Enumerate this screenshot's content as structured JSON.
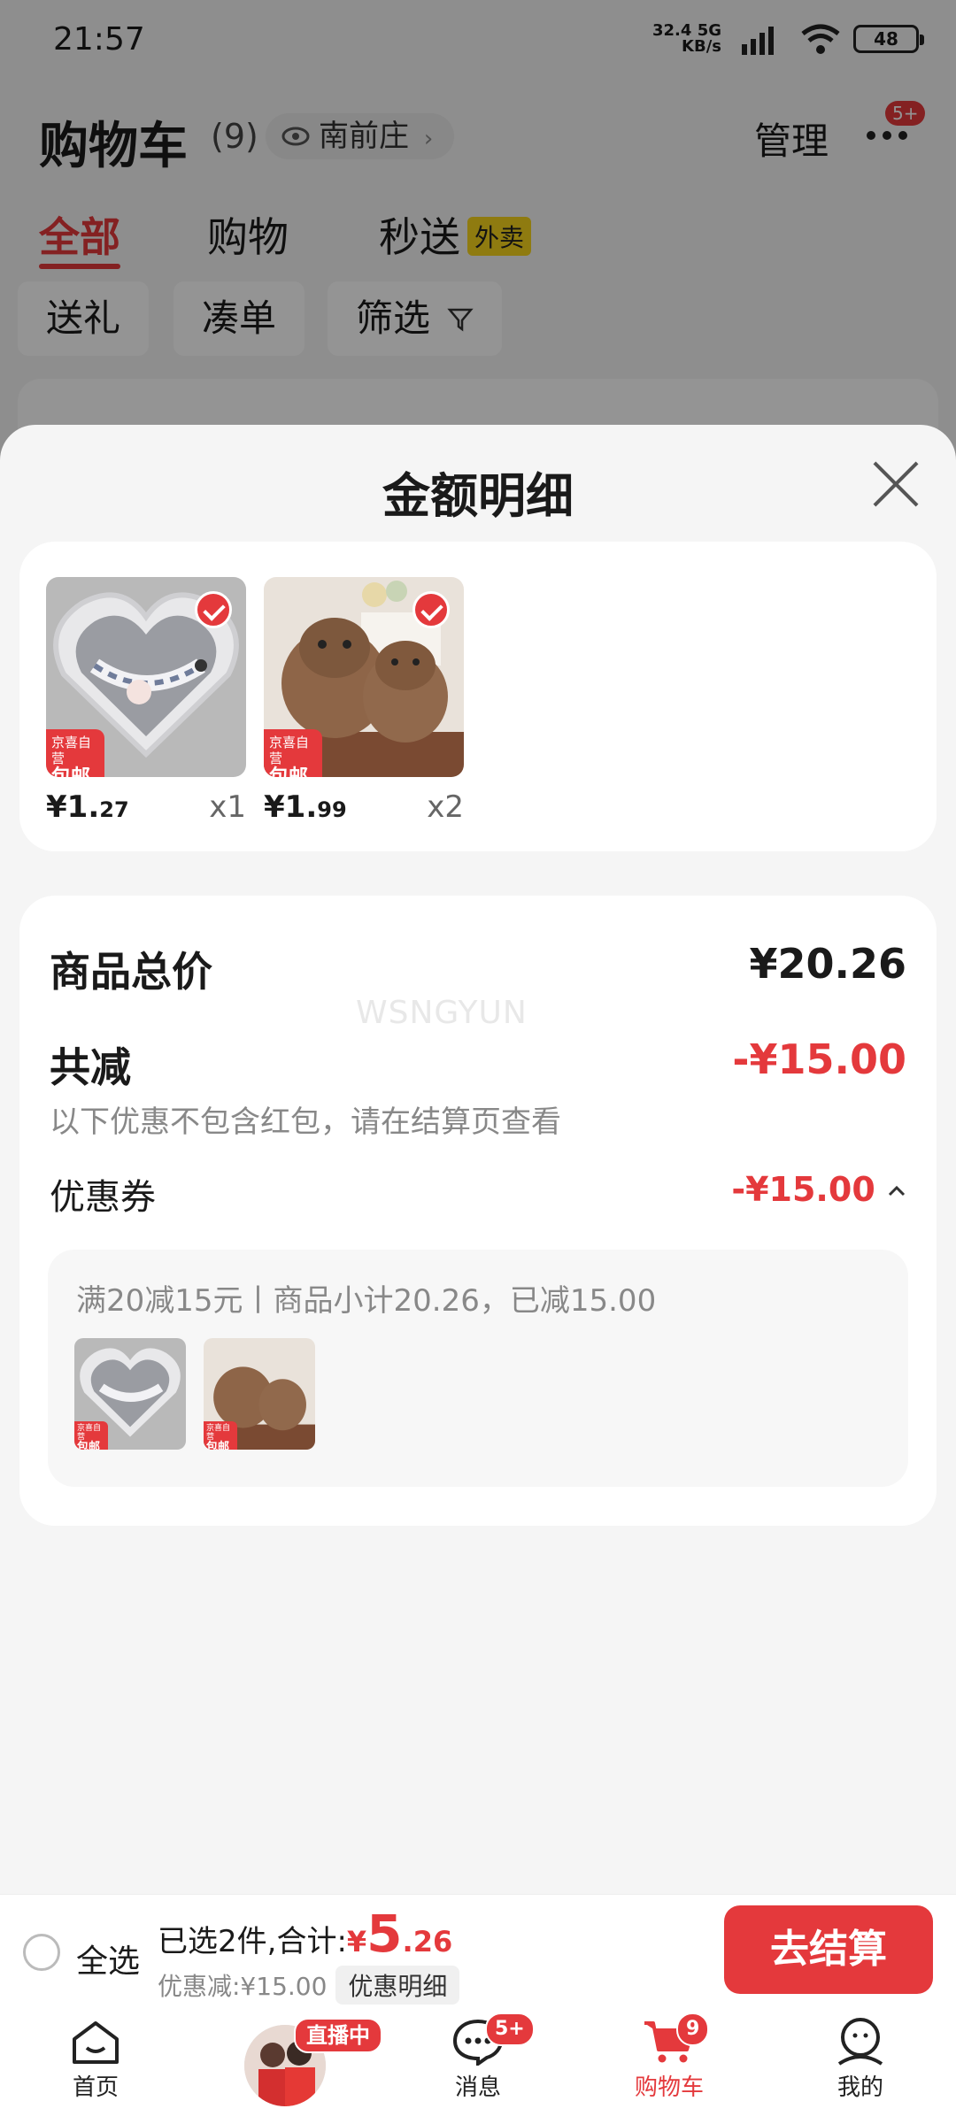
{
  "status_bar": {
    "time": "21:57",
    "network_speed": "32.4",
    "network_unit": "KB/s",
    "network_type": "5G",
    "battery": "48"
  },
  "header": {
    "title": "购物车",
    "count": "(9)",
    "location": "南前庄",
    "manage": "管理",
    "more_badge": "5+"
  },
  "tabs": [
    {
      "label": "全部"
    },
    {
      "label": "购物"
    },
    {
      "label": "秒送",
      "tag": "外卖"
    }
  ],
  "filters": [
    {
      "label": "送礼"
    },
    {
      "label": "凑单"
    },
    {
      "label": "筛选"
    }
  ],
  "sheet": {
    "title": "金额明细",
    "products": [
      {
        "price_int": "1.",
        "price_dec": "27",
        "currency": "¥",
        "qty": "x1",
        "tag_top": "京喜自营",
        "tag_bottom": "包邮"
      },
      {
        "price_int": "1.",
        "price_dec": "99",
        "currency": "¥",
        "qty": "x2",
        "tag_top": "京喜自营",
        "tag_bottom": "包邮"
      }
    ],
    "total_label": "商品总价",
    "total_value": "¥20.26",
    "discount_label": "共减",
    "discount_value": "-¥15.00",
    "discount_note": "以下优惠不包含红包，请在结算页查看",
    "coupon_label": "优惠券",
    "coupon_value": "-¥15.00",
    "coupon_detail": "满20减15元丨商品小计20.26，已减15.00",
    "watermark": "WSNGYUN"
  },
  "bottom_bar": {
    "select_all": "全选",
    "selected_text": "已选2件,合计:",
    "yen": "¥",
    "total_big": "5",
    "total_small": ".26",
    "discount_text": "优惠减:¥15.00",
    "detail_button": "优惠明细",
    "checkout": "去结算"
  },
  "nav": {
    "items": [
      {
        "label": "首页"
      },
      {
        "label": ""
      },
      {
        "label": "消息"
      },
      {
        "label": "购物车"
      },
      {
        "label": "我的"
      }
    ],
    "live_badge": "直播中",
    "msg_badge": "5+",
    "cart_badge": "9"
  },
  "colors": {
    "accent": "#e4393c",
    "takeaway_tag": "#f7d51d"
  }
}
